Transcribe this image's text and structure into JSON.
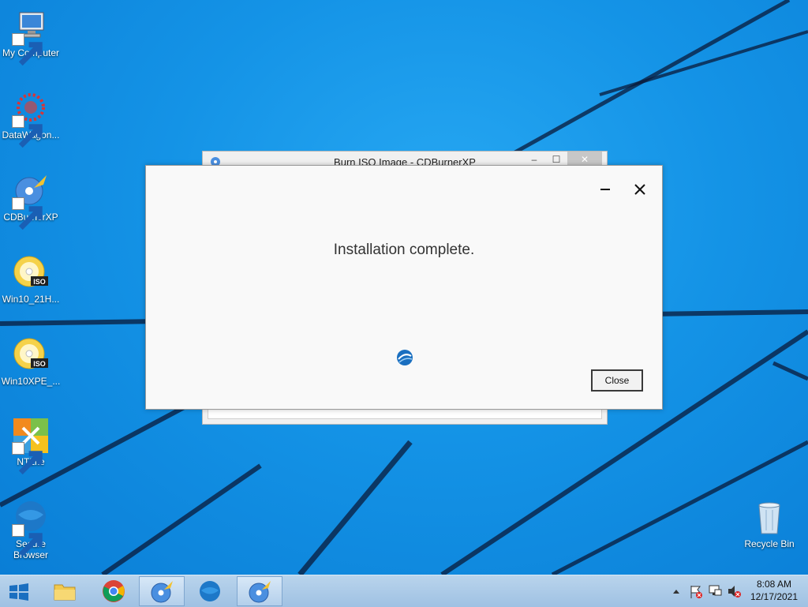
{
  "desktop": {
    "icons": [
      {
        "label": "My Computer",
        "icon": "computer-icon"
      },
      {
        "label": "DataWagon...",
        "icon": "datawagon-icon"
      },
      {
        "label": "CDBurnerXP",
        "icon": "cdburnerxp-icon"
      },
      {
        "label": "Win10_21H...",
        "icon": "iso-disc-icon"
      },
      {
        "label": "Win10XPE_...",
        "icon": "iso-disc-icon"
      },
      {
        "label": "NTLite",
        "icon": "ntlite-icon"
      },
      {
        "label": "Secure Browser",
        "label_line1": "Secure",
        "label_line2": "Browser",
        "icon": "secure-browser-icon"
      },
      {
        "label": "Recycle Bin",
        "icon": "recycle-bin-icon"
      }
    ]
  },
  "background_window": {
    "title": "Burn ISO Image - CDBurnerXP",
    "minimize": "–",
    "maximize": "☐",
    "close": "✕"
  },
  "dialog": {
    "message": "Installation complete.",
    "close_button": "Close"
  },
  "taskbar": {
    "clock_time": "8:08 AM",
    "clock_date": "12/17/2021",
    "apps": [
      "start-icon",
      "file-explorer-icon",
      "chrome-icon",
      "cdburnerxp-icon",
      "secure-browser-icon",
      "cdburnerxp-icon"
    ]
  },
  "colors": {
    "desktop_blue": "#1493e6",
    "taskbar": "#b9d4ec",
    "dialog_bg": "#f9f9f9"
  }
}
